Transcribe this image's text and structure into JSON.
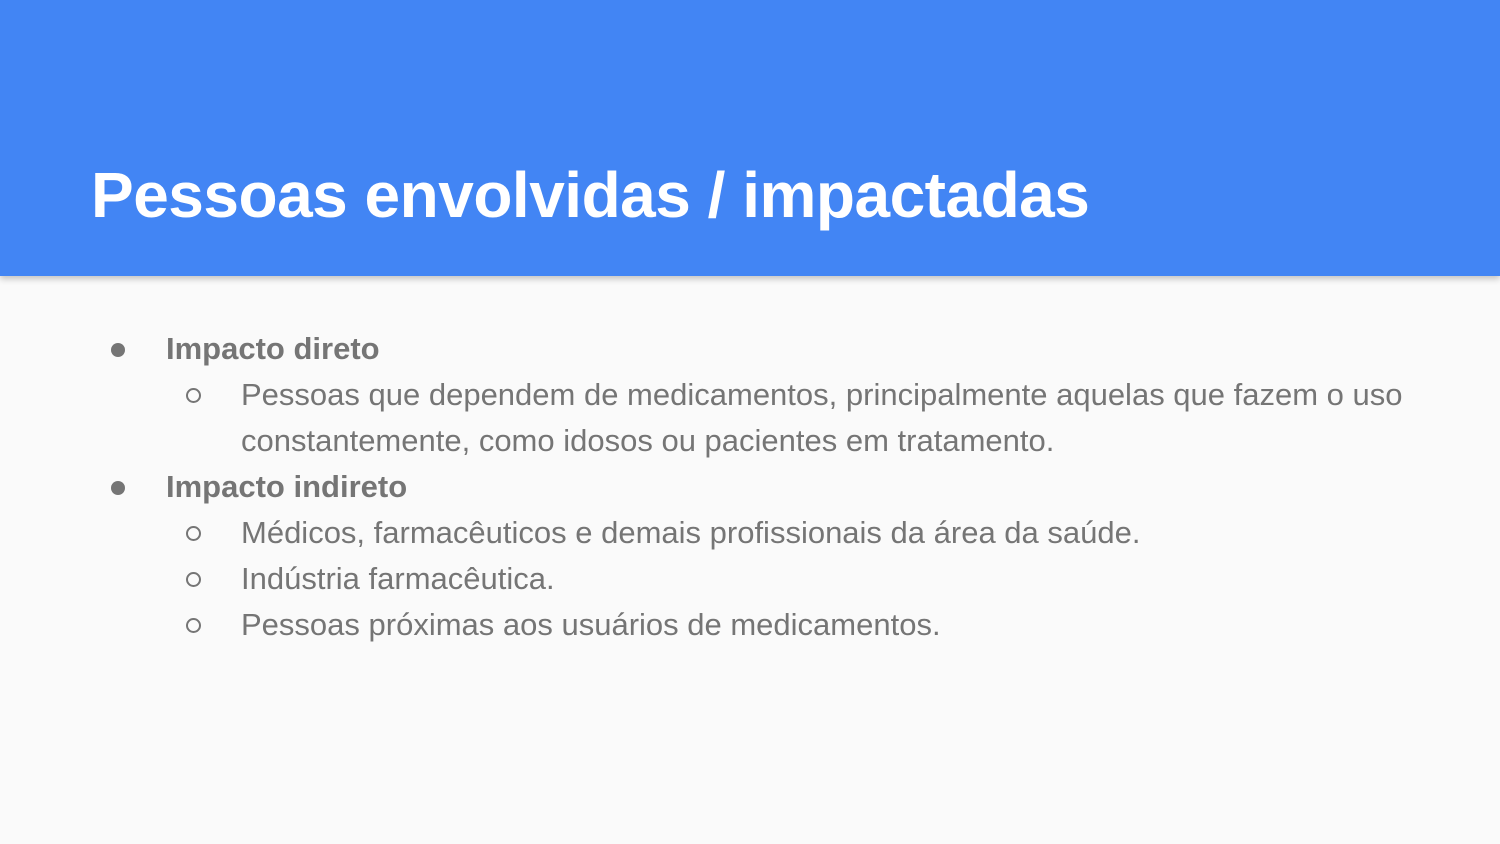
{
  "slide": {
    "title": "Pessoas envolvidas / impactadas",
    "header_color": "#4285f4",
    "text_color": "#757575",
    "sections": [
      {
        "heading": "Impacto direto",
        "items": [
          "Pessoas que dependem de medicamentos, principalmente aquelas que fazem o uso constantemente, como idosos ou pacientes em tratamento."
        ]
      },
      {
        "heading": "Impacto indireto",
        "items": [
          "Médicos, farmacêuticos e demais profissionais da área da saúde.",
          "Indústria farmacêutica.",
          "Pessoas próximas aos usuários de medicamentos."
        ]
      }
    ]
  }
}
